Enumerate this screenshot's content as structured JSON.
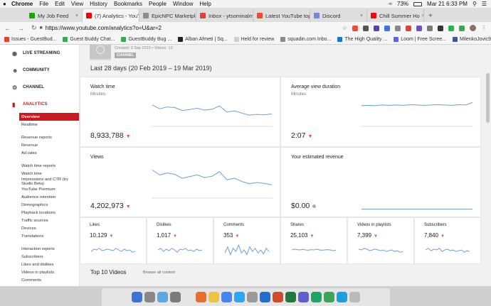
{
  "menubar": {
    "apple": "",
    "app": "Chrome",
    "items": [
      "File",
      "Edit",
      "View",
      "History",
      "Bookmarks",
      "People",
      "Window",
      "Help"
    ],
    "battery": "73%",
    "clock": "Mar 21  6:33 PM"
  },
  "tabs": [
    {
      "title": "My Job Feed",
      "color": "#14a800"
    },
    {
      "title": "(7) Analytics - YouTu",
      "color": "#ff0000",
      "active": true
    },
    {
      "title": "EpicNPC Marketplac",
      "color": "#8c8c8c"
    },
    {
      "title": "Inbox - ytsominalmil",
      "color": "#d44638"
    },
    {
      "title": "Latest YouTube top",
      "color": "#e94f2e"
    },
    {
      "title": "Discord",
      "color": "#7289da"
    },
    {
      "title": "Chill Summer Ho",
      "color": "#ff0000"
    }
  ],
  "address": {
    "url": "https://www.youtube.com/analytics?o=U&ar=2"
  },
  "bookmarks": [
    {
      "label": "Issues - GuestBud...",
      "color": "#e24329"
    },
    {
      "label": "Guest Buddy Chat...",
      "color": "#3aa757"
    },
    {
      "label": "GuestBuddy Bug ...",
      "color": "#3aa757"
    },
    {
      "label": "Alban Afmeti | Sq...",
      "color": "#222222"
    },
    {
      "label": "Held for review",
      "color": "#cfcfcf"
    },
    {
      "label": "squadin.com Inbo...",
      "color": "#8a8a8a"
    },
    {
      "label": "The High Quality ...",
      "color": "#1976d2"
    },
    {
      "label": "Loom | Free Scree...",
      "color": "#625df5"
    },
    {
      "label": "MilenkoJovic9654...",
      "color": "#3b5998"
    }
  ],
  "sidebar": {
    "sections": [
      {
        "label": "LIVE STREAMING",
        "icon": "broadcast-icon"
      },
      {
        "label": "COMMUNITY",
        "icon": "people-icon"
      },
      {
        "label": "CHANNEL",
        "icon": "gear-icon"
      },
      {
        "label": "ANALYTICS",
        "icon": "bar-chart-icon"
      }
    ],
    "analytics_items": [
      [
        "Overview",
        "Realtime"
      ],
      [
        "Revenue reports",
        "Revenue",
        "Ad rates"
      ],
      [
        "Watch time reports",
        "Watch time",
        "Impressions and CTR (try Studio Beta)",
        "YouTube Premium",
        "Audience retention",
        "Demographics",
        "Playback locations",
        "Traffic sources",
        "Devices",
        "Translations"
      ],
      [
        "Interaction reports",
        "Subscribers",
        "Likes and dislikes",
        "Videos in playlists",
        "Comments"
      ]
    ]
  },
  "channel": {
    "created": "Created: 3 Sep 2010  •  Videos: 13",
    "badge": "CHANNEL"
  },
  "period": "Last 28 days (20 Feb 2019 – 19 Mar 2019)",
  "cards": {
    "watch_time": {
      "label": "Watch time",
      "sub": "Minutes",
      "value": "8,933,788",
      "trend": [
        0.7,
        0.55,
        0.62,
        0.6,
        0.48,
        0.52,
        0.57,
        0.5,
        0.53,
        0.66,
        0.42,
        0.47,
        0.38,
        0.3,
        0.33,
        0.31,
        0.35
      ]
    },
    "avg_duration": {
      "label": "Average view duration",
      "sub": "Minutes",
      "value": "2:07",
      "trend": [
        0.55,
        0.56,
        0.55,
        0.57,
        0.56,
        0.57,
        0.56,
        0.58,
        0.57,
        0.56,
        0.57,
        0.58,
        0.57,
        0.56,
        0.58,
        0.57,
        0.65
      ]
    },
    "views": {
      "label": "Views",
      "sub": "",
      "value": "4,202,973",
      "trend": [
        0.75,
        0.6,
        0.66,
        0.62,
        0.5,
        0.55,
        0.6,
        0.52,
        0.56,
        0.7,
        0.45,
        0.5,
        0.4,
        0.33,
        0.37,
        0.34,
        0.3
      ]
    },
    "revenue": {
      "label": "Your estimated revenue",
      "sub": "",
      "value": "$0.00",
      "trend": [
        0.05,
        0.05,
        0.05,
        0.05,
        0.05,
        0.05,
        0.05,
        0.05,
        0.05,
        0.05,
        0.05,
        0.05,
        0.05,
        0.05,
        0.05,
        0.05,
        0.05
      ]
    }
  },
  "mini": [
    {
      "label": "Likes",
      "value": "10,129",
      "trend": [
        0.4,
        0.55,
        0.5,
        0.6,
        0.45,
        0.5,
        0.55,
        0.5,
        0.45,
        0.6,
        0.5,
        0.4,
        0.55,
        0.45,
        0.5,
        0.35,
        0.4
      ]
    },
    {
      "label": "Dislikes",
      "value": "1,017",
      "trend": [
        0.5,
        0.6,
        0.4,
        0.55,
        0.45,
        0.6,
        0.5,
        0.35,
        0.55,
        0.5,
        0.6,
        0.45,
        0.5,
        0.4,
        0.55,
        0.45,
        0.5
      ]
    },
    {
      "label": "Comments",
      "value": "353",
      "trend": [
        0.3,
        0.7,
        0.2,
        0.6,
        0.4,
        0.8,
        0.3,
        0.5,
        0.2,
        0.7,
        0.4,
        0.6,
        0.3,
        0.5,
        0.25,
        0.6,
        0.4
      ]
    },
    {
      "label": "Shares",
      "value": "25,103",
      "trend": [
        0.5,
        0.55,
        0.52,
        0.5,
        0.53,
        0.5,
        0.48,
        0.52,
        0.5,
        0.55,
        0.5,
        0.48,
        0.5,
        0.52,
        0.5,
        0.45,
        0.48
      ]
    },
    {
      "label": "Videos in playlists",
      "value": "7,399",
      "trend": [
        0.55,
        0.5,
        0.6,
        0.55,
        0.45,
        0.5,
        0.55,
        0.5,
        0.45,
        0.5,
        0.4,
        0.45,
        0.5,
        0.4,
        0.45,
        0.35,
        0.4
      ]
    },
    {
      "label": "Subscribers",
      "value": "7,840",
      "trend": [
        0.5,
        0.6,
        0.45,
        0.55,
        0.5,
        0.6,
        0.4,
        0.5,
        0.55,
        0.45,
        0.5,
        0.4,
        0.45,
        0.5,
        0.35,
        0.45,
        0.4
      ]
    }
  ],
  "top10": {
    "title": "Top 10 Videos",
    "browse": "Browse all content"
  },
  "dock_apps": [
    "#3a74d8",
    "#888888",
    "#5aa9e6",
    "#7b7b7b",
    "#e5e5e5",
    "#e96d2c",
    "#f0c33c",
    "#4285f4",
    "#2aa7f0",
    "#9a9a9a",
    "#1f6fd1",
    "#d24a2c",
    "#1f7a3c",
    "#5f5fd0",
    "#21a366",
    "#3aa757",
    "#1aa0e0",
    "#bbbbbb"
  ]
}
